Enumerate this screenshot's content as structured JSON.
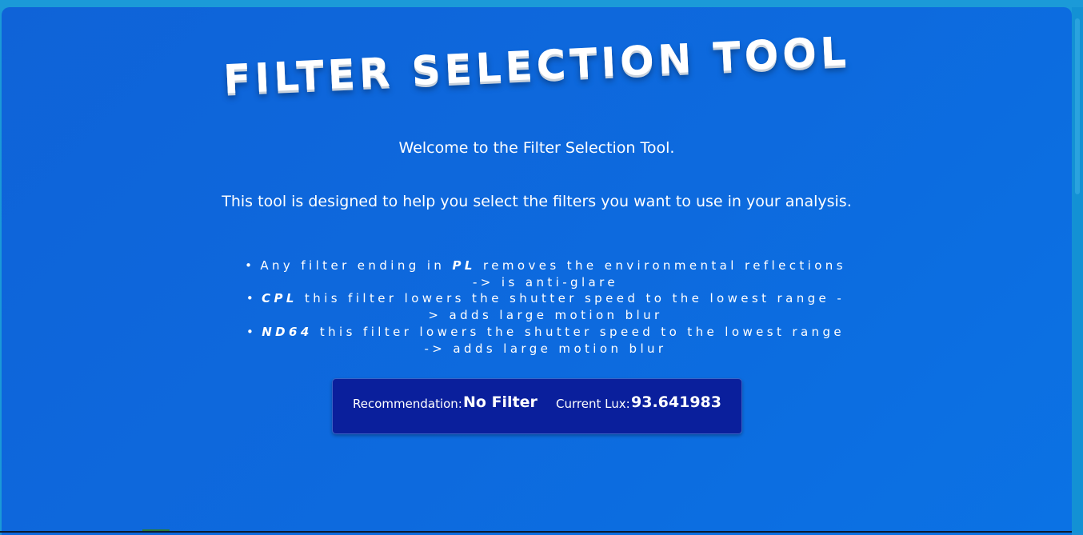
{
  "page": {
    "title": "FILTER SELECTION TOOL",
    "welcome": "Welcome to the Filter Selection Tool.",
    "description": "This tool is designed to help you select the filters you want to use in your analysis."
  },
  "notes": [
    {
      "before": "Any filter ending in ",
      "keyword": "PL",
      "after": " removes the environmental reflections -> is anti-glare"
    },
    {
      "before": "",
      "keyword": "CPL",
      "after": " this filter lowers the shutter speed to the lowest range -> adds large motion blur"
    },
    {
      "before": "",
      "keyword": "ND64",
      "after": " this filter lowers the shutter speed to the lowest range -> adds large motion blur"
    }
  ],
  "recommendation": {
    "label": "Recommendation:",
    "value": "No Filter",
    "lux_label": "Current Lux:",
    "lux_value": "93.641983"
  },
  "colors": {
    "background": "#0f63d8",
    "box": "#0a1f9c",
    "text": "#ffffff"
  }
}
